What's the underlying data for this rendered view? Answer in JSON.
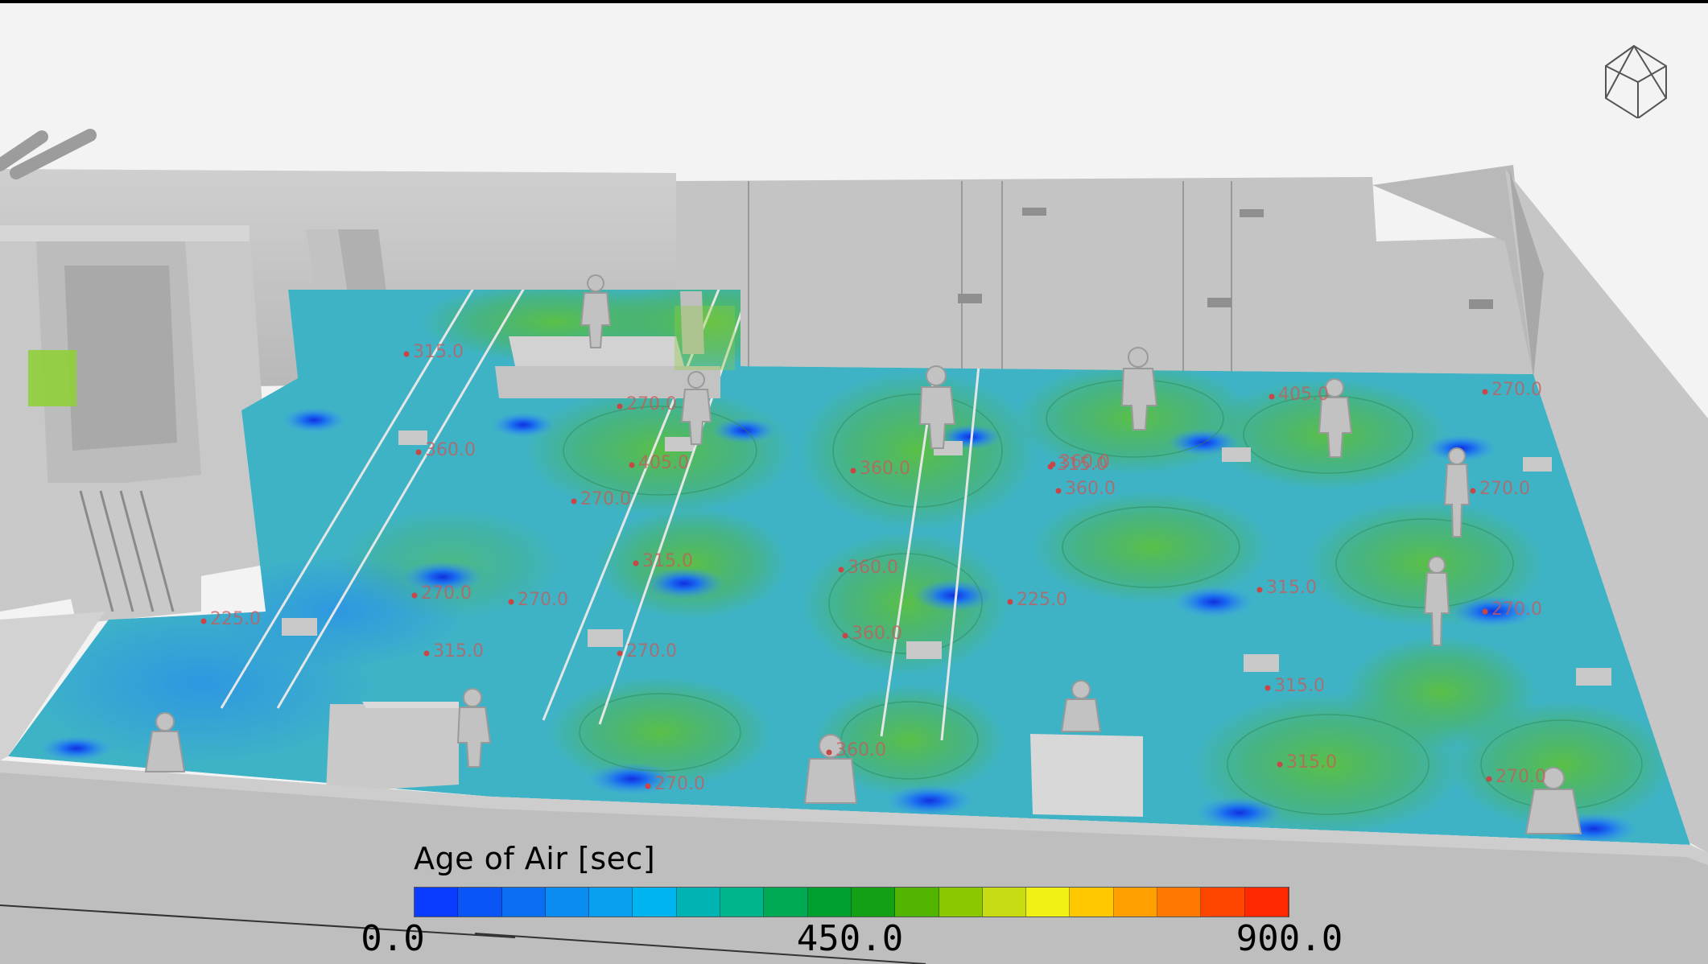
{
  "legend": {
    "title": "Age of Air [sec]",
    "min_label": "0.0",
    "mid_label": "450.0",
    "max_label": "900.0",
    "colors": [
      "#0a3cff",
      "#0a55f5",
      "#0a6ef0",
      "#0a8cf0",
      "#0aa0f0",
      "#00b4f0",
      "#00b4b4",
      "#00b48c",
      "#00aa55",
      "#00a030",
      "#14a014",
      "#50b400",
      "#8cc800",
      "#c8dc14",
      "#f0f014",
      "#ffc800",
      "#ffa000",
      "#ff7800",
      "#ff4600",
      "#ff2800"
    ]
  },
  "probes": [
    "315.0",
    "270.0",
    "360.0",
    "405.0",
    "270.0",
    "360.0",
    "315.0",
    "360.0",
    "270.0",
    "315.0",
    "360.0",
    "270.0",
    "270.0",
    "225.0",
    "315.0",
    "270.0",
    "315.0",
    "270.0",
    "360.0",
    "315.0",
    "270.0",
    "360.0",
    "315.0",
    "270.0",
    "225.0",
    "270.0",
    "405.0",
    "360.0"
  ],
  "scene": {
    "floor_base_color": "#3cb4c8",
    "wall_color": "#bdbdbd",
    "background_color": "#f2f2f2",
    "figures_count": 14,
    "icon": "view-cube-icon"
  }
}
